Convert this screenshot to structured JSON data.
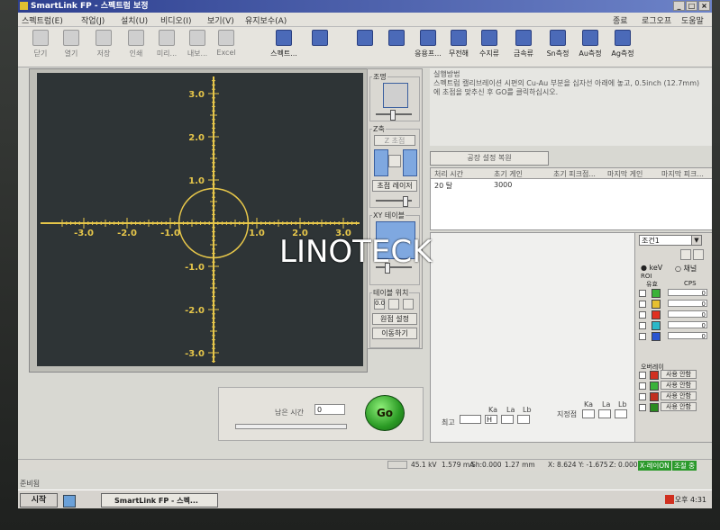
{
  "window": {
    "title": "SmartLink FP - 스펙트럼 보정"
  },
  "menu": [
    "스펙트럼(E)",
    "작업(J)",
    "설치(U)",
    "비디오(I)",
    "보기(V)",
    "유지보수(A)"
  ],
  "menu_right": [
    "종료",
    "로그오프",
    "도움말"
  ],
  "toolbar": [
    {
      "label": "닫기",
      "active": false
    },
    {
      "label": "열기",
      "active": false
    },
    {
      "label": "저장",
      "active": false
    },
    {
      "label": "인쇄",
      "active": false
    },
    {
      "label": "미리...",
      "active": false
    },
    {
      "label": "내보...",
      "active": false
    },
    {
      "label": "Excel",
      "active": false
    },
    {
      "label": "스펙트...",
      "active": true
    },
    {
      "label": "",
      "active": true
    },
    {
      "label": "",
      "active": true
    },
    {
      "label": "",
      "active": true
    },
    {
      "label": "응용프...",
      "active": true
    },
    {
      "label": "무전해",
      "active": true
    },
    {
      "label": "수지류",
      "active": true
    },
    {
      "label": "금속류",
      "active": true
    },
    {
      "label": "Sn측정",
      "active": true
    },
    {
      "label": "Au측정",
      "active": true
    },
    {
      "label": "Ag측정",
      "active": true
    }
  ],
  "plot": {
    "x_ticks": [
      "-3.0",
      "-2.0",
      "-1.0",
      "1.0",
      "2.0",
      "3.0"
    ],
    "y_ticks": [
      "3.0",
      "2.0",
      "1.0",
      "-1.0",
      "-2.0",
      "-3.0"
    ],
    "axis_color": "#e6c64a"
  },
  "controls": {
    "light_title": "조명",
    "z_title": "Z축",
    "z_focus": "Z 초점",
    "focus_laser": "초점 레이저",
    "xy_title": "XY 테이블",
    "table_pos_title": "테이블 위치",
    "pos_value": "0.0",
    "origin_set": "원점 설정",
    "move": "이동하기"
  },
  "instructions": {
    "title": "실행방법",
    "line1": "스펙트럼 캘리브레이션 시편의 Cu-Au 부분을 십자선 아래에 놓고, 0.5inch (12.7mm)",
    "line2": "에 초점을 맞추신 후 GO를 클릭하십시오."
  },
  "reset_button": "공장 설정 복원",
  "table": {
    "headers": [
      "처리 시간",
      "초기 게인",
      "초기 피크점...",
      "마지막 게인",
      "마지막 피크..."
    ],
    "rows": [
      [
        "20 탈",
        "3000",
        "",
        "",
        ""
      ]
    ]
  },
  "spectrum": {
    "peak_label": "최고",
    "fix_label": "지정점",
    "k_labels": [
      "Ka",
      "La",
      "Lb"
    ],
    "box_value": "H"
  },
  "side": {
    "condition": "조건1",
    "energy_radio": "keV",
    "channel_radio": "채널",
    "roi_title": "ROI",
    "col_valid": "유효",
    "col_cps": "CPS",
    "roi_colors": [
      "#39b239",
      "#e6c030",
      "#e03020",
      "#2ab8c8",
      "#2b55d0"
    ],
    "roi_values": [
      "0",
      "0",
      "0",
      "0",
      "0"
    ],
    "overlay_title": "오버레이",
    "overlay_colors": [
      "#d03020",
      "#39b239",
      "#c03020",
      "#2a8a20"
    ],
    "overlay_btn": "사용 안함"
  },
  "go_panel": {
    "remaining_label": "남은 시간",
    "remaining_value": "0",
    "go_label": "Go"
  },
  "status": {
    "kv": "45.1 kV",
    "ma": "1.579 mA",
    "sh": "Sh:0.000",
    "mm": "1.27 mm",
    "x": "X: 8.624",
    "y": "Y: -1.675",
    "z": "Z: 0.000",
    "laser": "X-레이ON",
    "state": "조절 중",
    "time": "오후 4:31"
  },
  "taskbar": {
    "ready": "준비됨",
    "start": "시작",
    "app": "SmartLink FP - 스펙..."
  },
  "watermark": "LINOTECK"
}
